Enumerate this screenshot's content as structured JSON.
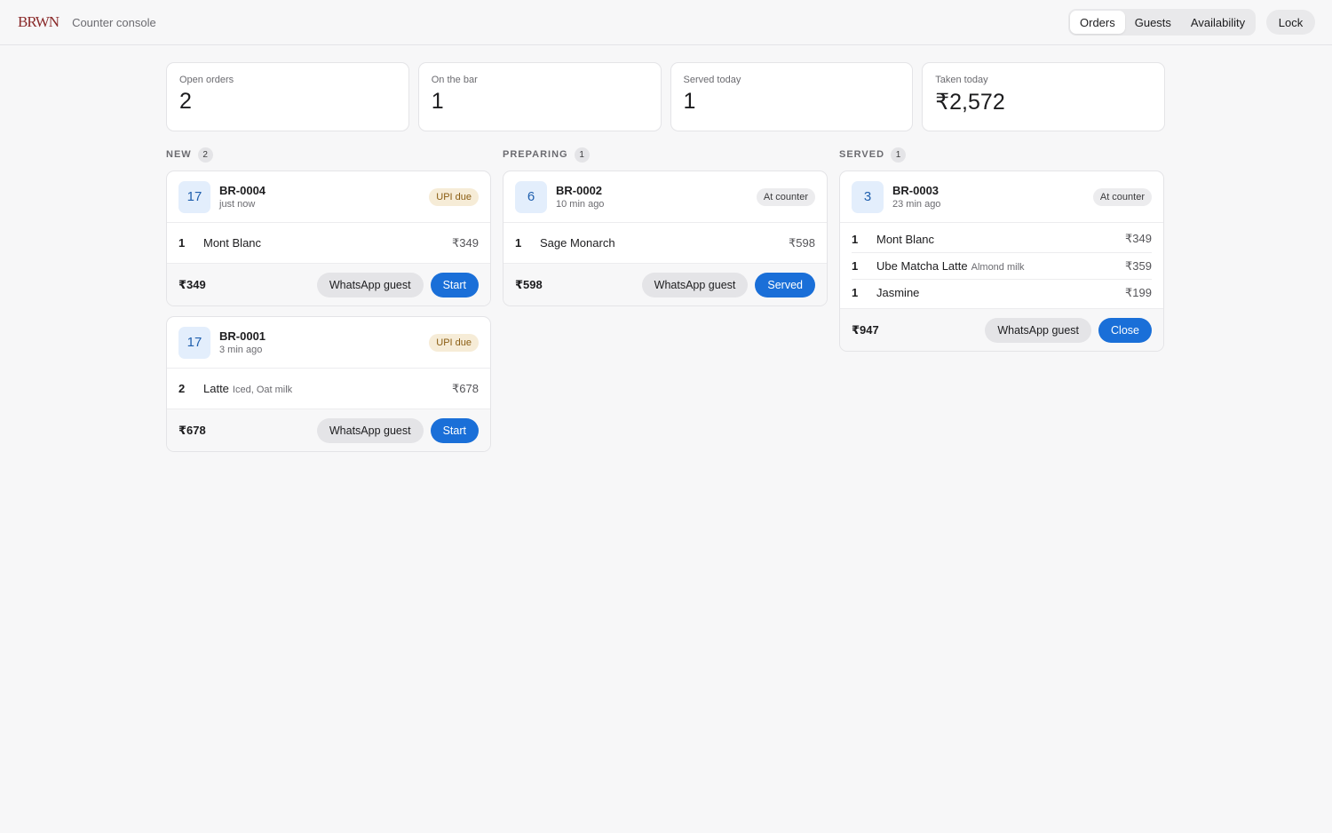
{
  "header": {
    "logo_text": "BRWN",
    "console_label": "Counter console",
    "tabs": [
      {
        "label": "Orders",
        "active": true
      },
      {
        "label": "Guests",
        "active": false
      },
      {
        "label": "Availability",
        "active": false
      }
    ],
    "lock_label": "Lock"
  },
  "stats": [
    {
      "label": "Open orders",
      "value": "2"
    },
    {
      "label": "On the bar",
      "value": "1"
    },
    {
      "label": "Served today",
      "value": "1"
    },
    {
      "label": "Taken today",
      "value": "₹2,572"
    }
  ],
  "columns": [
    {
      "title": "NEW",
      "count": "2",
      "orders": [
        {
          "table": "17",
          "id": "BR-0004",
          "time": "just now",
          "badge": "UPI due",
          "badge_type": "upi",
          "items": [
            {
              "qty": "1",
              "name": "Mont Blanc",
              "mods": "",
              "price": "₹349"
            }
          ],
          "total": "₹349",
          "whatsapp_label": "WhatsApp guest",
          "action_label": "Start"
        },
        {
          "table": "17",
          "id": "BR-0001",
          "time": "3 min ago",
          "badge": "UPI due",
          "badge_type": "upi",
          "items": [
            {
              "qty": "2",
              "name": "Latte",
              "mods": "Iced, Oat milk",
              "price": "₹678"
            }
          ],
          "total": "₹678",
          "whatsapp_label": "WhatsApp guest",
          "action_label": "Start"
        }
      ]
    },
    {
      "title": "PREPARING",
      "count": "1",
      "orders": [
        {
          "table": "6",
          "id": "BR-0002",
          "time": "10 min ago",
          "badge": "At counter",
          "badge_type": "counter",
          "items": [
            {
              "qty": "1",
              "name": "Sage Monarch",
              "mods": "",
              "price": "₹598"
            }
          ],
          "total": "₹598",
          "whatsapp_label": "WhatsApp guest",
          "action_label": "Served"
        }
      ]
    },
    {
      "title": "SERVED",
      "count": "1",
      "orders": [
        {
          "table": "3",
          "id": "BR-0003",
          "time": "23 min ago",
          "badge": "At counter",
          "badge_type": "counter",
          "items": [
            {
              "qty": "1",
              "name": "Mont Blanc",
              "mods": "",
              "price": "₹349"
            },
            {
              "qty": "1",
              "name": "Ube Matcha Latte",
              "mods": "Almond milk",
              "price": "₹359"
            },
            {
              "qty": "1",
              "name": "Jasmine",
              "mods": "",
              "price": "₹199"
            }
          ],
          "total": "₹947",
          "whatsapp_label": "WhatsApp guest",
          "action_label": "Close"
        }
      ]
    }
  ]
}
